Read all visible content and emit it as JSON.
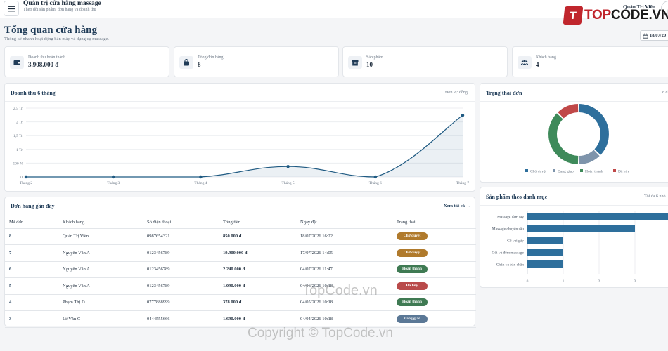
{
  "header": {
    "title": "Quản trị cửa hàng massage",
    "subtitle": "Theo dõi sản phẩm, đơn hàng và doanh thu",
    "logo_mark": "T",
    "logo_text_1": "TOP",
    "logo_text_2": "CODE.VN",
    "user_name": "Quản Trị Viên"
  },
  "page": {
    "title": "Tổng quan cửa hàng",
    "subtitle": "Thống kê nhanh hoạt động bán máy và dụng cụ massage.",
    "date": "18/07/20"
  },
  "stats": [
    {
      "label": "Doanh thu hoàn thành",
      "value": "3.908.000 đ",
      "icon": "wallet-icon"
    },
    {
      "label": "Tổng đơn hàng",
      "value": "8",
      "icon": "bag-icon"
    },
    {
      "label": "Sản phẩm",
      "value": "10",
      "icon": "box-icon"
    },
    {
      "label": "Khách hàng",
      "value": "4",
      "icon": "users-icon"
    }
  ],
  "revenue_card": {
    "title": "Doanh thu 6 tháng",
    "unit": "Đơn vị: đồng"
  },
  "status_card": {
    "title": "Trạng thái đơn",
    "right": "8 đ"
  },
  "category_card": {
    "title": "Sản phẩm theo danh mục",
    "right": "Tối đa 6 nhó"
  },
  "orders_card": {
    "title": "Đơn hàng gần đây",
    "view_all": "Xem tất cả",
    "columns": [
      "Mã đơn",
      "Khách hàng",
      "Số điện thoại",
      "Tổng tiền",
      "Ngày đặt",
      "Trạng thái"
    ],
    "rows": [
      {
        "id": "8",
        "customer": "Quản Trị Viên",
        "phone": "0987654321",
        "total": "850.000 đ",
        "date": "18/07/2026 16:22",
        "status": "Chờ duyệt",
        "color": "#b07a2c"
      },
      {
        "id": "7",
        "customer": "Nguyễn Văn A",
        "phone": "0123456789",
        "total": "19.900.000 đ",
        "date": "17/07/2026 14:05",
        "status": "Chờ duyệt",
        "color": "#b07a2c"
      },
      {
        "id": "6",
        "customer": "Nguyễn Văn A",
        "phone": "0123456789",
        "total": "2.240.000 đ",
        "date": "04/07/2026 11:47",
        "status": "Hoàn thành",
        "color": "#3f7a53"
      },
      {
        "id": "5",
        "customer": "Nguyễn Văn A",
        "phone": "0123456789",
        "total": "1.090.000 đ",
        "date": "04/06/2026 10:18",
        "status": "Đã hủy",
        "color": "#b94a4a"
      },
      {
        "id": "4",
        "customer": "Phạm Thị D",
        "phone": "0777888999",
        "total": "378.000 đ",
        "date": "04/05/2026 10:18",
        "status": "Hoàn thành",
        "color": "#3f7a53"
      },
      {
        "id": "3",
        "customer": "Lê Văn C",
        "phone": "0444555666",
        "total": "1.690.000 đ",
        "date": "04/04/2026 10:18",
        "status": "Đang giao",
        "color": "#5b7896"
      }
    ]
  },
  "watermark": {
    "center": "TopCode.vn",
    "bottom": "Copyright © TopCode.vn"
  },
  "chart_data": [
    {
      "type": "area",
      "title": "Doanh thu 6 tháng",
      "categories": [
        "Tháng 2",
        "Tháng 3",
        "Tháng 4",
        "Tháng 5",
        "Tháng 6",
        "Tháng 7"
      ],
      "values": [
        0,
        0,
        0,
        378000,
        0,
        2240000
      ],
      "yticks": [
        "0",
        "500 N",
        "1 Tr",
        "1,5 Tr",
        "2 Tr",
        "2,5 Tr"
      ],
      "ylim": [
        0,
        2500000
      ],
      "grid": true,
      "color": "#1f5a82"
    },
    {
      "type": "pie",
      "title": "Trạng thái đơn",
      "categories": [
        "Chờ duyệt",
        "Đang giao",
        "Hoàn thành",
        "Đã hủy"
      ],
      "values": [
        3,
        1,
        3,
        1
      ],
      "colors": [
        "#2e6f9c",
        "#7e94ab",
        "#3e8a5a",
        "#c04848"
      ],
      "legend": "bottom"
    },
    {
      "type": "bar",
      "title": "Sản phẩm theo danh mục",
      "orientation": "horizontal",
      "categories": [
        "Massage cầm tay",
        "Massage chuyên sâu",
        "Cổ vai gáy",
        "Gối và đệm massage",
        "Chân và bàn chân"
      ],
      "values": [
        4,
        3,
        1,
        1,
        1
      ],
      "xticks": [
        "0",
        "1",
        "2",
        "3"
      ],
      "xlim": [
        0,
        4
      ],
      "color": "#2e6f9c"
    }
  ]
}
